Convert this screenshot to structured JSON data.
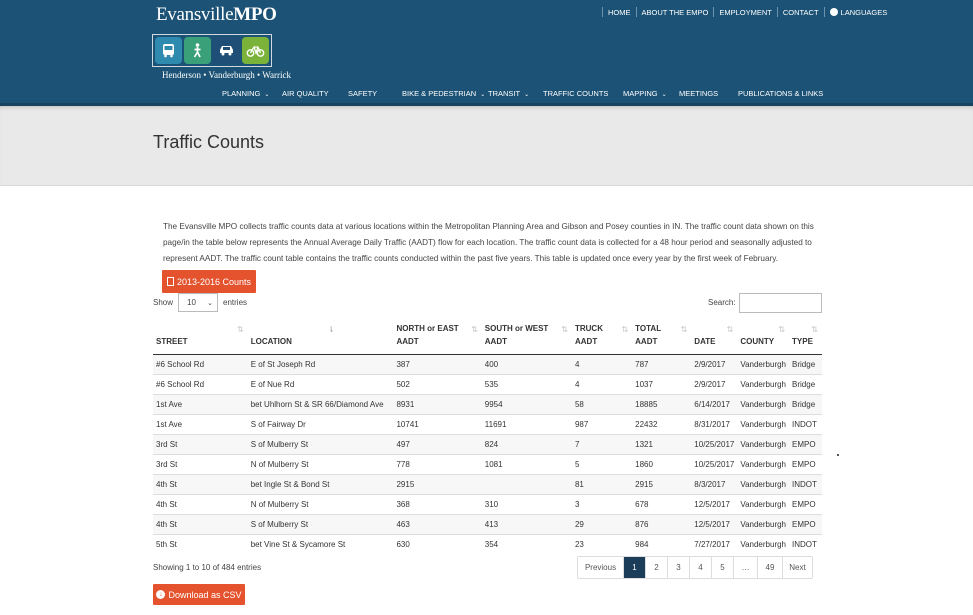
{
  "brand": {
    "title_a": "Evansville",
    "title_b": "MPO",
    "subtitle": "Henderson • Vanderburgh • Warrick"
  },
  "top_nav": [
    "HOME",
    "ABOUT THE EMPO",
    "EMPLOYMENT",
    "CONTACT",
    "LANGUAGES"
  ],
  "main_nav": [
    {
      "label": "PLANNING",
      "has_menu": true
    },
    {
      "label": "AIR QUALITY",
      "has_menu": false
    },
    {
      "label": "SAFETY",
      "has_menu": false
    },
    {
      "label": "BIKE & PEDESTRIAN",
      "has_menu": true
    },
    {
      "label": "TRANSIT",
      "has_menu": true
    },
    {
      "label": "TRAFFIC COUNTS",
      "has_menu": false
    },
    {
      "label": "MAPPING",
      "has_menu": true
    },
    {
      "label": "MEETINGS",
      "has_menu": false
    },
    {
      "label": "PUBLICATIONS & LINKS",
      "has_menu": false
    }
  ],
  "page_title": "Traffic Counts",
  "intro": "The Evansville MPO collects traffic counts data at various locations within the Metropolitan Planning Area and Gibson and Posey counties in IN. The traffic count data shown on this page/in the table below represents the Annual Average Daily Traffic (AADT) flow for each location. The traffic count data is collected for a 48 hour period and seasonally adjusted to represent AADT. The traffic count table contains the traffic counts conducted within the past five years. This table is updated once every year by the first week of February.",
  "counts_button": "2013-2016 Counts",
  "show_label": "Show",
  "entries_value": "10",
  "entries_label": "entries",
  "search_label": "Search:",
  "columns": [
    [
      "STREET"
    ],
    [
      "LOCATION"
    ],
    [
      "NORTH or EAST",
      "AADT"
    ],
    [
      "SOUTH or WEST",
      "AADT"
    ],
    [
      "TRUCK",
      "AADT"
    ],
    [
      "TOTAL",
      "AADT"
    ],
    [
      "DATE"
    ],
    [
      "COUNTY"
    ],
    [
      "TYPE"
    ]
  ],
  "rows": [
    [
      "#6 School Rd",
      "E of St Joseph Rd",
      "387",
      "400",
      "4",
      "787",
      "2/9/2017",
      "Vanderburgh",
      "Bridge"
    ],
    [
      "#6 School Rd",
      "E of Nue Rd",
      "502",
      "535",
      "4",
      "1037",
      "2/9/2017",
      "Vanderburgh",
      "Bridge"
    ],
    [
      "1st Ave",
      "bet Uhlhorn St & SR 66/Diamond Ave",
      "8931",
      "9954",
      "58",
      "18885",
      "6/14/2017",
      "Vanderburgh",
      "Bridge"
    ],
    [
      "1st Ave",
      "S of Fairway Dr",
      "10741",
      "11691",
      "987",
      "22432",
      "8/31/2017",
      "Vanderburgh",
      "INDOT"
    ],
    [
      "3rd St",
      "S of Mulberry St",
      "497",
      "824",
      "7",
      "1321",
      "10/25/2017",
      "Vanderburgh",
      "EMPO"
    ],
    [
      "3rd St",
      "N of Mulberry St",
      "778",
      "1081",
      "5",
      "1860",
      "10/25/2017",
      "Vanderburgh",
      "EMPO"
    ],
    [
      "4th St",
      "bet Ingle St & Bond St",
      "2915",
      "",
      "81",
      "2915",
      "8/3/2017",
      "Vanderburgh",
      "INDOT"
    ],
    [
      "4th St",
      "N of Mulberry St",
      "368",
      "310",
      "3",
      "678",
      "12/5/2017",
      "Vanderburgh",
      "EMPO"
    ],
    [
      "4th St",
      "S of Mulberry St",
      "463",
      "413",
      "29",
      "876",
      "12/5/2017",
      "Vanderburgh",
      "EMPO"
    ],
    [
      "5th St",
      "bet Vine St & Sycamore St",
      "630",
      "354",
      "23",
      "984",
      "7/27/2017",
      "Vanderburgh",
      "INDOT"
    ]
  ],
  "info": "Showing 1 to 10 of 484 entries",
  "pagination": [
    "Previous",
    "1",
    "2",
    "3",
    "4",
    "5",
    "…",
    "49",
    "Next"
  ],
  "pagination_active": "1",
  "csv_button": "Download as CSV"
}
